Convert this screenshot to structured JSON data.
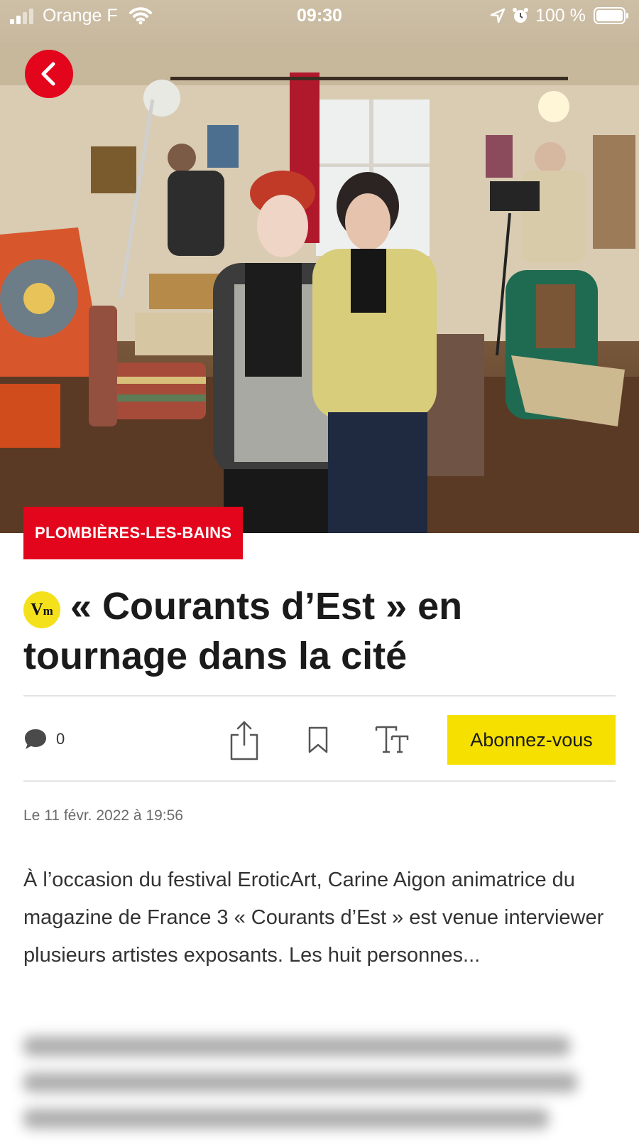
{
  "status_bar": {
    "carrier": "Orange F",
    "time": "09:30",
    "battery": "100 %",
    "icons": [
      "signal-icon",
      "wifi-icon",
      "location-icon",
      "alarm-icon",
      "battery-icon"
    ]
  },
  "article": {
    "category": "PLOMBIÈRES-LES-BAINS",
    "badge": "Vm",
    "title": "« Courants d’Est » en tournage dans la cité",
    "comments_count": "0",
    "subscribe_label": "Abonnez-vous",
    "date": "Le 11 févr. 2022 à 19:56",
    "lead": "À l’occasion du festival EroticArt, Carine Aigon animatrice du magazine de France 3 « Courants d’Est » est venue interviewer plusieurs artistes exposants. Les huit personnes..."
  },
  "colors": {
    "accent_red": "#e3051b",
    "subscribe_yellow": "#f5e000",
    "badge_yellow": "#f5e11b"
  },
  "icons": {
    "back": "back-arrow-icon",
    "comments": "comment-bubble-icon",
    "share": "share-icon",
    "bookmark": "bookmark-icon",
    "text_size": "text-size-icon"
  }
}
